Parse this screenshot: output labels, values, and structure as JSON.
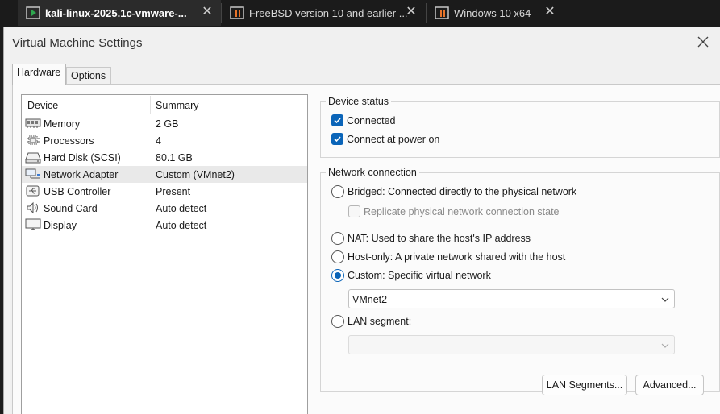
{
  "tabs": [
    {
      "title": "kali-linux-2025.1c-vmware-...",
      "icon": "vm-running-icon"
    },
    {
      "title": "FreeBSD version 10 and earlier ...",
      "icon": "vm-paused-icon"
    },
    {
      "title": "Windows 10 x64",
      "icon": "vm-paused-icon"
    }
  ],
  "dialog": {
    "title": "Virtual Machine Settings",
    "tabs": {
      "hardware": "Hardware",
      "options": "Options"
    }
  },
  "devices": {
    "header": {
      "device": "Device",
      "summary": "Summary"
    },
    "items": [
      {
        "name": "Memory",
        "summary": "2 GB",
        "icon": "memory-icon"
      },
      {
        "name": "Processors",
        "summary": "4",
        "icon": "processor-icon"
      },
      {
        "name": "Hard Disk (SCSI)",
        "summary": "80.1 GB",
        "icon": "hard-disk-icon"
      },
      {
        "name": "Network Adapter",
        "summary": "Custom (VMnet2)",
        "icon": "network-adapter-icon"
      },
      {
        "name": "USB Controller",
        "summary": "Present",
        "icon": "usb-icon"
      },
      {
        "name": "Sound Card",
        "summary": "Auto detect",
        "icon": "speaker-icon"
      },
      {
        "name": "Display",
        "summary": "Auto detect",
        "icon": "display-icon"
      }
    ]
  },
  "device_status": {
    "legend": "Device status",
    "connected": "Connected",
    "connect_at_power_on": "Connect at power on"
  },
  "network": {
    "legend": "Network connection",
    "bridged": "Bridged: Connected directly to the physical network",
    "replicate": "Replicate physical network connection state",
    "nat": "NAT: Used to share the host's IP address",
    "host_only": "Host-only: A private network shared with the host",
    "custom": "Custom: Specific virtual network",
    "custom_value": "VMnet2",
    "lan_segment": "LAN segment:",
    "lan_value": ""
  },
  "buttons": {
    "lan_segments": "LAN Segments...",
    "advanced": "Advanced..."
  },
  "colors": {
    "accent": "#0a64b8",
    "selected_row": "#e9e9e9",
    "titlebar_bg": "#1b1b1b"
  }
}
